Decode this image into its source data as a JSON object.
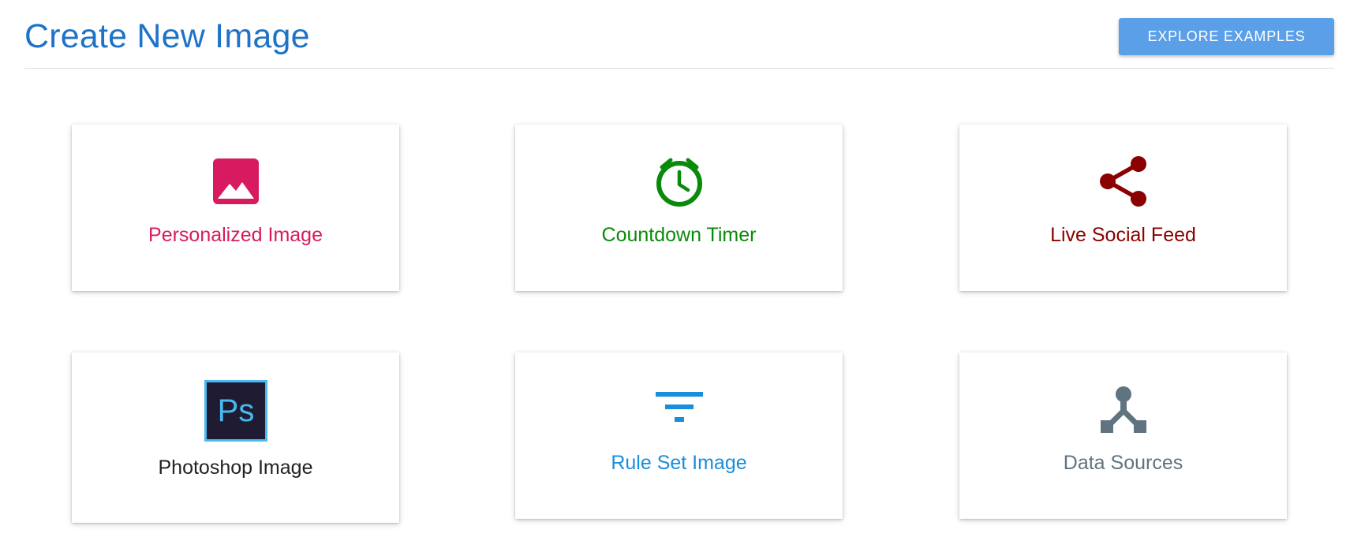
{
  "header": {
    "title": "Create New Image",
    "explore_button": "EXPLORE EXAMPLES"
  },
  "colors": {
    "title": "#1e73c8",
    "button": "#5a9fe8"
  },
  "cards": [
    {
      "label": "Personalized Image",
      "icon": "image-icon",
      "color": "#d81b60"
    },
    {
      "label": "Countdown Timer",
      "icon": "alarm-clock-icon",
      "color": "#0a8a0a"
    },
    {
      "label": "Live Social Feed",
      "icon": "share-icon",
      "color": "#8b0000"
    },
    {
      "label": "Photoshop Image",
      "icon": "photoshop-icon",
      "color": "#222222"
    },
    {
      "label": "Rule Set Image",
      "icon": "filter-icon",
      "color": "#1a8ddb"
    },
    {
      "label": "Data Sources",
      "icon": "data-sources-icon",
      "color": "#5f7380"
    }
  ]
}
